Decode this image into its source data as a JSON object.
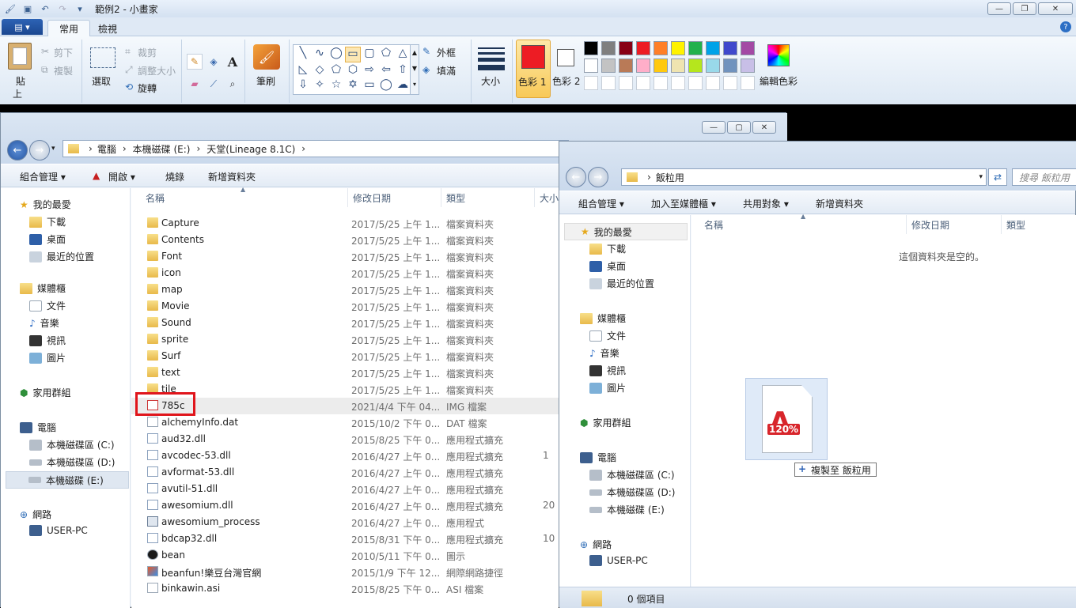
{
  "paint": {
    "title": "範例2 - 小畫家",
    "tabs": [
      "常用",
      "檢視"
    ],
    "clipboard": {
      "paste": "貼",
      "paste2": "上",
      "cut": "剪下",
      "copy": "複製"
    },
    "image": {
      "select": "選取",
      "crop": "裁剪",
      "resize": "調整大小",
      "rotate": "旋轉"
    },
    "brush": "筆刷",
    "shapes": {
      "outline": "外框",
      "fill": "填滿"
    },
    "size": "大小",
    "color1": "色彩 1",
    "color2": "色彩 2",
    "edit_colors": "編輯色彩",
    "palette": [
      "#000000",
      "#7f7f7f",
      "#880015",
      "#ed1c24",
      "#ff7f27",
      "#fff200",
      "#22b14c",
      "#00a2e8",
      "#3f48cc",
      "#a349a4",
      "#ffffff",
      "#c3c3c3",
      "#b97a57",
      "#ffaec9",
      "#ffc90e",
      "#efe4b0",
      "#b5e61d",
      "#99d9ea",
      "#7092be",
      "#c8bfe7"
    ],
    "accent": "#ed1c24"
  },
  "ex1": {
    "breadcrumb": [
      "電腦",
      "本機磁碟 (E:)",
      "天堂(Lineage 8.1C)"
    ],
    "commands": [
      "組合管理",
      "開啟",
      "燒錄",
      "新增資料夾"
    ],
    "headers": {
      "name": "名稱",
      "date": "修改日期",
      "type": "類型",
      "size": "大小"
    },
    "nav": {
      "fav": "我的最愛",
      "downloads": "下載",
      "desktop": "桌面",
      "recent": "最近的位置",
      "libs": "媒體櫃",
      "docs": "文件",
      "music": "音樂",
      "video": "視訊",
      "pics": "圖片",
      "home": "家用群組",
      "pc": "電腦",
      "c": "本機磁碟區 (C:)",
      "d": "本機磁碟區 (D:)",
      "e": "本機磁碟 (E:)",
      "net": "網路",
      "user": "USER-PC"
    },
    "files": [
      {
        "name": "Capture",
        "date": "2017/5/25 上午 1...",
        "type": "檔案資料夾",
        "size": "",
        "kind": "folder"
      },
      {
        "name": "Contents",
        "date": "2017/5/25 上午 1...",
        "type": "檔案資料夾",
        "size": "",
        "kind": "folder"
      },
      {
        "name": "Font",
        "date": "2017/5/25 上午 1...",
        "type": "檔案資料夾",
        "size": "",
        "kind": "folder"
      },
      {
        "name": "icon",
        "date": "2017/5/25 上午 1...",
        "type": "檔案資料夾",
        "size": "",
        "kind": "folder"
      },
      {
        "name": "map",
        "date": "2017/5/25 上午 1...",
        "type": "檔案資料夾",
        "size": "",
        "kind": "folder"
      },
      {
        "name": "Movie",
        "date": "2017/5/25 上午 1...",
        "type": "檔案資料夾",
        "size": "",
        "kind": "folder"
      },
      {
        "name": "Sound",
        "date": "2017/5/25 上午 1...",
        "type": "檔案資料夾",
        "size": "",
        "kind": "folder"
      },
      {
        "name": "sprite",
        "date": "2017/5/25 上午 1...",
        "type": "檔案資料夾",
        "size": "",
        "kind": "folder"
      },
      {
        "name": "Surf",
        "date": "2017/5/25 上午 1...",
        "type": "檔案資料夾",
        "size": "",
        "kind": "folder"
      },
      {
        "name": "text",
        "date": "2017/5/25 上午 1...",
        "type": "檔案資料夾",
        "size": "",
        "kind": "folder"
      },
      {
        "name": "tile",
        "date": "2017/5/25 上午 1...",
        "type": "檔案資料夾",
        "size": "",
        "kind": "folder"
      },
      {
        "name": "785c",
        "date": "2021/4/4 下午 04...",
        "type": "IMG 檔案",
        "size": "",
        "kind": "img"
      },
      {
        "name": "alchemyInfo.dat",
        "date": "2015/10/2 下午 0...",
        "type": "DAT 檔案",
        "size": "",
        "kind": "file"
      },
      {
        "name": "aud32.dll",
        "date": "2015/8/25 下午 0...",
        "type": "應用程式擴充",
        "size": "",
        "kind": "dll"
      },
      {
        "name": "avcodec-53.dll",
        "date": "2016/4/27 上午 0...",
        "type": "應用程式擴充",
        "size": "1",
        "kind": "dll"
      },
      {
        "name": "avformat-53.dll",
        "date": "2016/4/27 上午 0...",
        "type": "應用程式擴充",
        "size": "",
        "kind": "dll"
      },
      {
        "name": "avutil-51.dll",
        "date": "2016/4/27 上午 0...",
        "type": "應用程式擴充",
        "size": "",
        "kind": "dll"
      },
      {
        "name": "awesomium.dll",
        "date": "2016/4/27 上午 0...",
        "type": "應用程式擴充",
        "size": "20",
        "kind": "dll"
      },
      {
        "name": "awesomium_process",
        "date": "2016/4/27 上午 0...",
        "type": "應用程式",
        "size": "",
        "kind": "exe"
      },
      {
        "name": "bdcap32.dll",
        "date": "2015/8/31 下午 0...",
        "type": "應用程式擴充",
        "size": "10",
        "kind": "dll"
      },
      {
        "name": "bean",
        "date": "2010/5/11 下午 0...",
        "type": "圖示",
        "size": "",
        "kind": "bean"
      },
      {
        "name": "beanfun!樂豆台灣官網",
        "date": "2015/1/9 下午 12...",
        "type": "網際網路捷徑",
        "size": "",
        "kind": "link"
      },
      {
        "name": "binkawin.asi",
        "date": "2015/8/25 下午 0...",
        "type": "ASI 檔案",
        "size": "",
        "kind": "file"
      }
    ]
  },
  "ex2": {
    "breadcrumb": "飯粒用",
    "search_placeholder": "搜尋 飯粒用",
    "commands": [
      "組合管理",
      "加入至媒體櫃",
      "共用對象",
      "新增資料夾"
    ],
    "headers": {
      "name": "名稱",
      "date": "修改日期",
      "type": "類型"
    },
    "empty": "這個資料夾是空的。",
    "drag_icon_text": "120%",
    "drag_tooltip": "複製至 飯粒用",
    "status": "0 個項目",
    "nav": {
      "fav": "我的最愛",
      "downloads": "下載",
      "desktop": "桌面",
      "recent": "最近的位置",
      "libs": "媒體櫃",
      "docs": "文件",
      "music": "音樂",
      "video": "視訊",
      "pics": "圖片",
      "home": "家用群組",
      "pc": "電腦",
      "c": "本機磁碟區 (C:)",
      "d": "本機磁碟區 (D:)",
      "e": "本機磁碟 (E:)",
      "net": "網路",
      "user": "USER-PC"
    }
  }
}
